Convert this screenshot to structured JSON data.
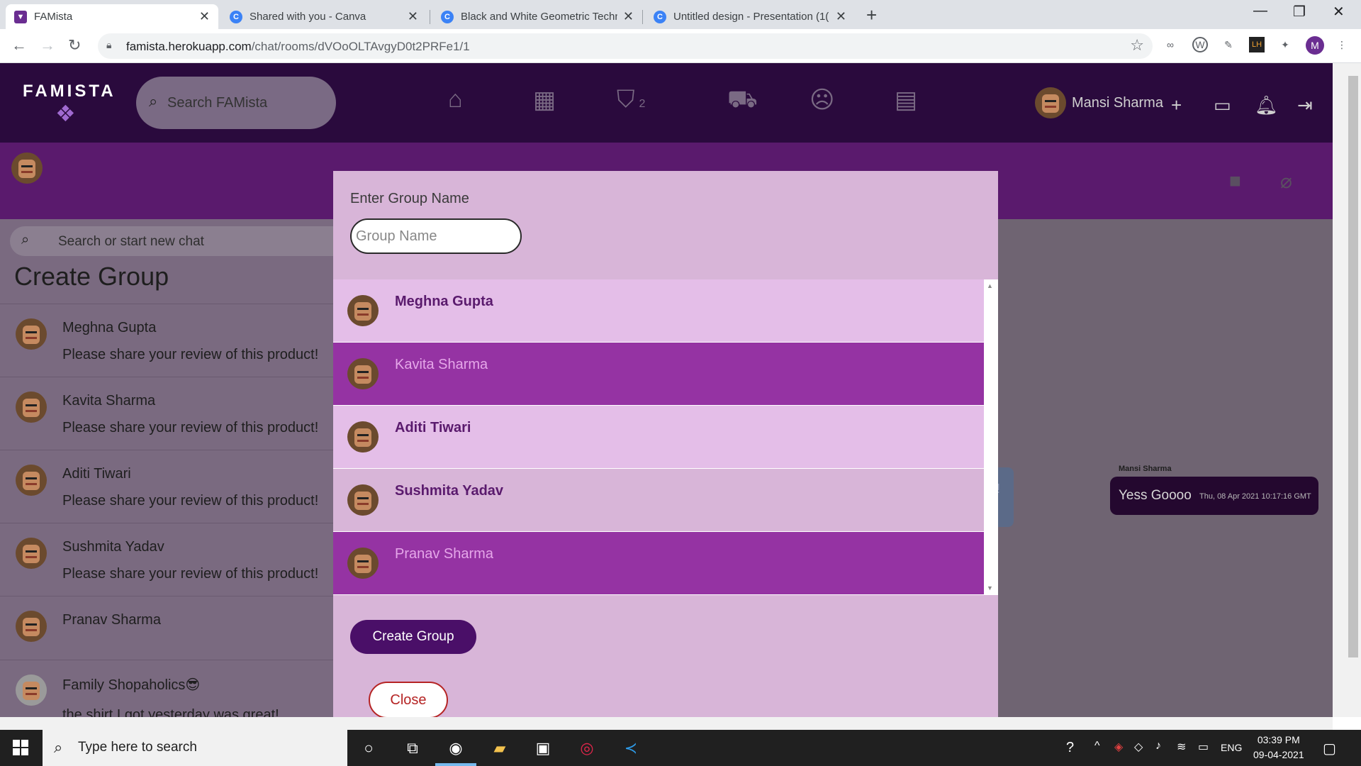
{
  "browser": {
    "tabs": [
      {
        "title": "FAMista",
        "active": true
      },
      {
        "title": "Shared with you - Canva",
        "active": false
      },
      {
        "title": "Black and White Geometric Techn",
        "active": false
      },
      {
        "title": "Untitled design - Presentation (1(",
        "active": false
      }
    ],
    "url_host": "famista.herokuapp.com",
    "url_path": "/chat/rooms/dVOoOLTAvgyD0t2PRFe1/1",
    "profile_initial": "M"
  },
  "app": {
    "logo": "FAMISTA",
    "search_placeholder": "Search FAMista",
    "cart_count": "2",
    "user_name": "Mansi Sharma"
  },
  "sidebar": {
    "search_placeholder": "Search or start new chat",
    "title": "Create Group",
    "chats": [
      {
        "name": "Meghna Gupta",
        "message": "Please share your review of this product!"
      },
      {
        "name": "Kavita Sharma",
        "message": "Please share your review of this product!"
      },
      {
        "name": "Aditi Tiwari",
        "message": "Please share your review of this product!"
      },
      {
        "name": "Sushmita Yadav",
        "message": "Please share your review of this product!"
      },
      {
        "name": "Pranav Sharma",
        "message": ""
      },
      {
        "name": "Family Shopaholics😎",
        "message": "the shirt I got yesterday was great!"
      }
    ]
  },
  "chat": {
    "sender": "Mansi Sharma",
    "message": "Yess Goooo",
    "timestamp": "Thu, 08 Apr 2021 10:17:16 GMT",
    "partial_text": "n!"
  },
  "modal": {
    "label": "Enter Group Name",
    "input_placeholder": "Group Name",
    "input_value": "",
    "members": [
      {
        "name": "Meghna Gupta",
        "state": "plain"
      },
      {
        "name": "Kavita Sharma",
        "state": "selected"
      },
      {
        "name": "Aditi Tiwari",
        "state": "plain"
      },
      {
        "name": "Sushmita Yadav",
        "state": "hover"
      },
      {
        "name": "Pranav Sharma",
        "state": "selected"
      }
    ],
    "create_label": "Create Group",
    "close_label": "Close"
  },
  "taskbar": {
    "search_placeholder": "Type here to search",
    "lang": "ENG",
    "time": "03:39 PM",
    "date": "09-04-2021"
  },
  "colors": {
    "brand_dark": "#2a0a3d",
    "brand_purple": "#5a1a6d",
    "selected_row": "#9533a3",
    "close_red": "#b52424"
  }
}
